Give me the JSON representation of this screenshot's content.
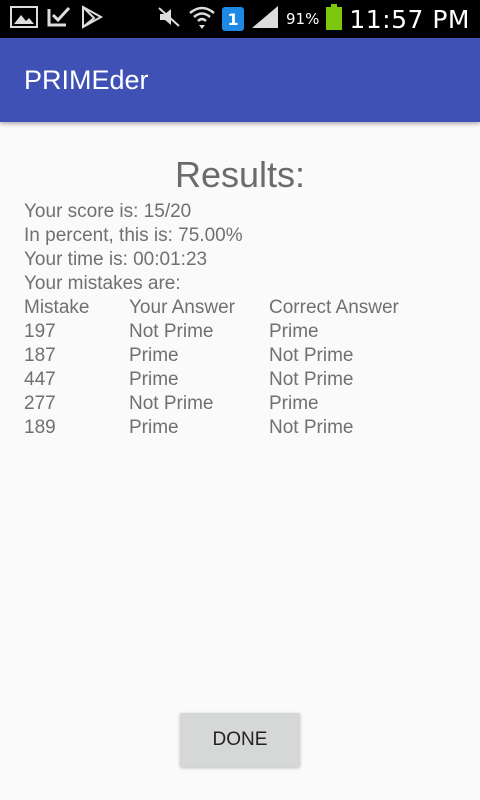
{
  "status_bar": {
    "battery_percent": "91%",
    "time": "11:57 PM",
    "notification_badge": "1",
    "icons": [
      "gallery-icon",
      "download-done-icon",
      "play-store-icon",
      "mute-icon",
      "wifi-icon",
      "notification-badge-icon",
      "signal-icon",
      "battery-icon"
    ]
  },
  "app_bar": {
    "title": "PRIMEder"
  },
  "results": {
    "title": "Results:",
    "score_line": "Your score is: 15/20",
    "percent_line": "In percent, this is: 75.00%",
    "time_line": "Your time is: 00:01:23",
    "mistakes_heading": "Your mistakes are:",
    "columns": [
      "Mistake",
      "Your Answer",
      "Correct Answer"
    ],
    "rows": [
      [
        "197",
        "Not Prime",
        "Prime"
      ],
      [
        "187",
        "Prime",
        "Not Prime"
      ],
      [
        "447",
        "Prime",
        "Not Prime"
      ],
      [
        "277",
        "Not Prime",
        "Prime"
      ],
      [
        "189",
        "Prime",
        "Not Prime"
      ]
    ]
  },
  "done_button": {
    "label": "DONE"
  },
  "colors": {
    "app_bar": "#3f51b5",
    "battery": "#7cc80f",
    "badge": "#1e88e5"
  }
}
